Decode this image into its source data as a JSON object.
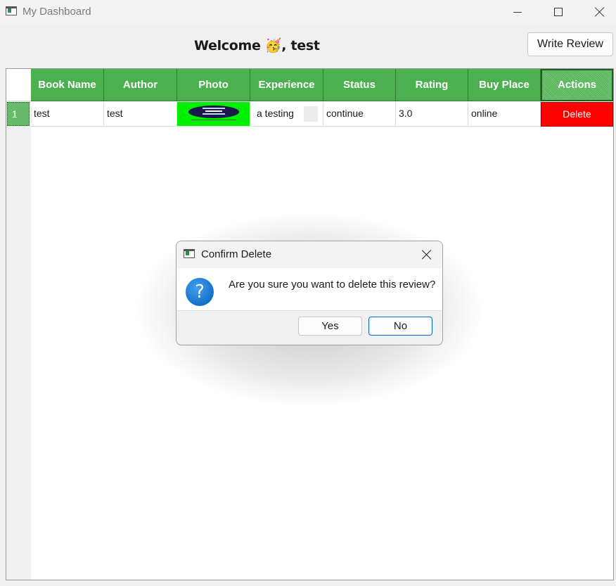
{
  "window": {
    "title": "My Dashboard",
    "icon": "window-app-icon"
  },
  "header": {
    "welcome_prefix": "Welcome",
    "welcome_emoji": "🥳",
    "welcome_suffix": ", test",
    "write_review_label": "Write Review"
  },
  "table": {
    "columns": [
      "Book Name",
      "Author",
      "Photo",
      "Experience",
      "Status",
      "Rating",
      "Buy Place",
      "Actions"
    ],
    "rows": [
      {
        "row_number": "1",
        "book_name": "test",
        "author": "test",
        "photo": "book-cover-thumbnail",
        "experience": "a testing",
        "status": "continue",
        "rating": "3.0",
        "buy_place": "online",
        "action_label": "Delete"
      }
    ],
    "colors": {
      "header_bg": "#4caf50",
      "photo_bg": "#00ee00",
      "delete_bg": "#ff0000"
    }
  },
  "dialog": {
    "title": "Confirm Delete",
    "icon": "question-icon",
    "message": "Are you sure you want to delete this review?",
    "yes_label": "Yes",
    "no_label": "No"
  }
}
